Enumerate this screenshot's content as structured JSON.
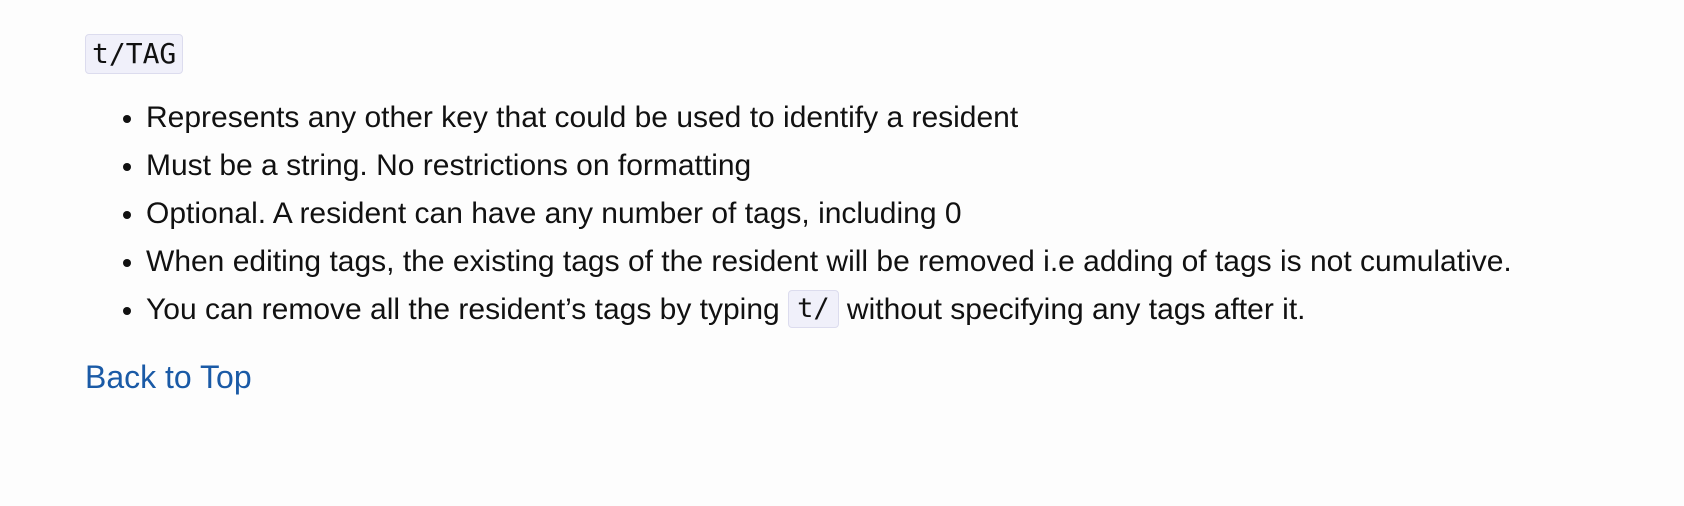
{
  "heading_code": "t/TAG",
  "bullets": [
    "Represents any other key that could be used to identify a resident",
    "Must be a string. No restrictions on formatting",
    "Optional. A resident can have any number of tags, including 0",
    "When editing tags, the existing tags of the resident will be removed i.e adding of tags is not cumulative."
  ],
  "last_bullet": {
    "before": "You can remove all the resident’s tags by typing ",
    "code": "t/",
    "after": " without specifying any tags after it."
  },
  "back_to_top": "Back to Top",
  "colors": {
    "link": "#1a5aa6",
    "code_background": "#f0f0fa",
    "text": "#111111"
  }
}
